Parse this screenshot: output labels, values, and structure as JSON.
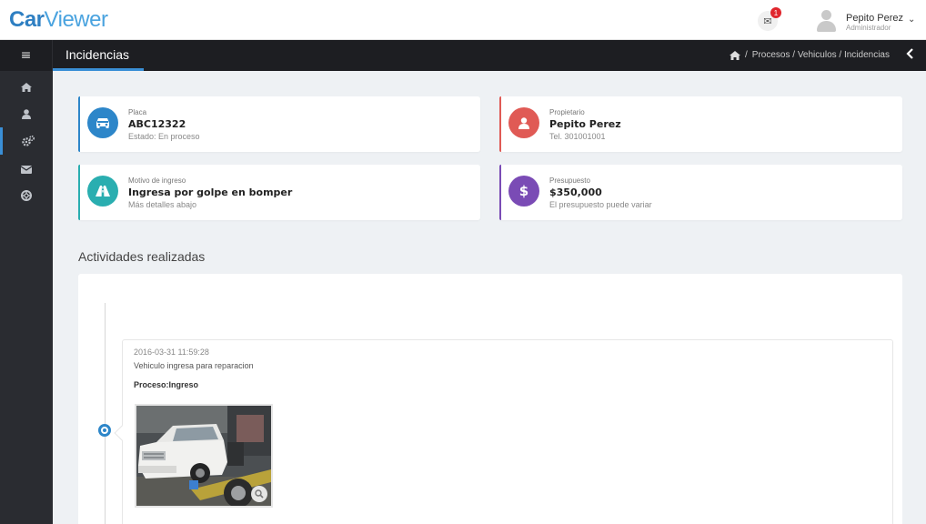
{
  "app": {
    "logo_part1": "Car",
    "logo_part2": "Viewer"
  },
  "header": {
    "notification_count": "1",
    "user_name": "Pepito Perez",
    "user_role": "Administrador"
  },
  "titlebar": {
    "page_title": "Incidencias",
    "breadcrumb_sep": "/",
    "breadcrumb": "Procesos / Vehiculos / Incidencias"
  },
  "sidebar": {
    "items": [
      {
        "icon": "home-icon"
      },
      {
        "icon": "user-icon"
      },
      {
        "icon": "cogs-icon"
      },
      {
        "icon": "envelope-icon"
      },
      {
        "icon": "lifebuoy-icon"
      }
    ]
  },
  "cards": {
    "plate": {
      "label": "Placa",
      "value": "ABC12322",
      "sub": "Estado: En proceso",
      "color": "#2d86c9",
      "icon": "car-icon"
    },
    "owner": {
      "label": "Propietario",
      "value": "Pepito Perez",
      "sub": "Tel. 301001001",
      "color": "#e05a55",
      "icon": "user-icon"
    },
    "reason": {
      "label": "Motivo de ingreso",
      "value": "Ingresa por golpe en bomper",
      "sub": "Más detalles abajo",
      "color": "#2aaeb0",
      "icon": "road-icon"
    },
    "budget": {
      "label": "Presupuesto",
      "value": "$350,000",
      "sub": "El presupuesto puede variar",
      "color": "#7a4bb5",
      "icon": "dollar-icon"
    }
  },
  "activities": {
    "title": "Actividades realizadas",
    "events": [
      {
        "timestamp": "2016-03-31 11:59:28",
        "description": "Vehiculo ingresa para reparacion",
        "process": "Proceso:Ingreso"
      }
    ]
  }
}
